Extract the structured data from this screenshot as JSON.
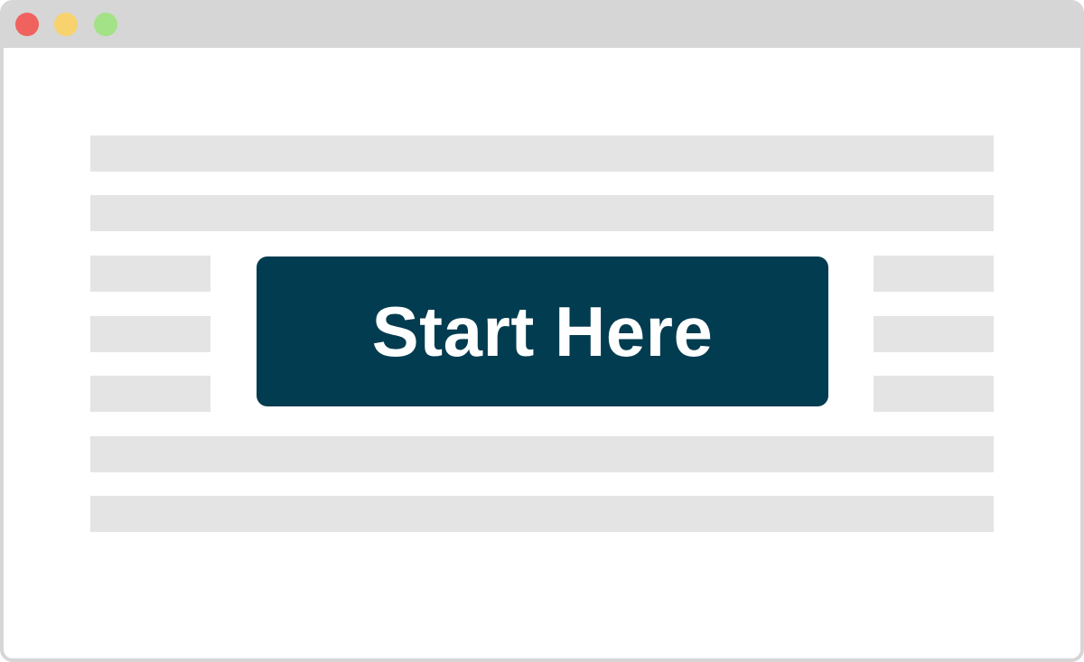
{
  "window": {
    "controls": [
      {
        "name": "close-icon",
        "color": "#f0625e"
      },
      {
        "name": "minimize-icon",
        "color": "#f8d26c"
      },
      {
        "name": "maximize-icon",
        "color": "#a3e286"
      }
    ]
  },
  "main": {
    "cta": {
      "label": "Start Here",
      "background": "#023c50",
      "text_color": "#ffffff"
    },
    "placeholder_color": "#e4e4e4"
  }
}
